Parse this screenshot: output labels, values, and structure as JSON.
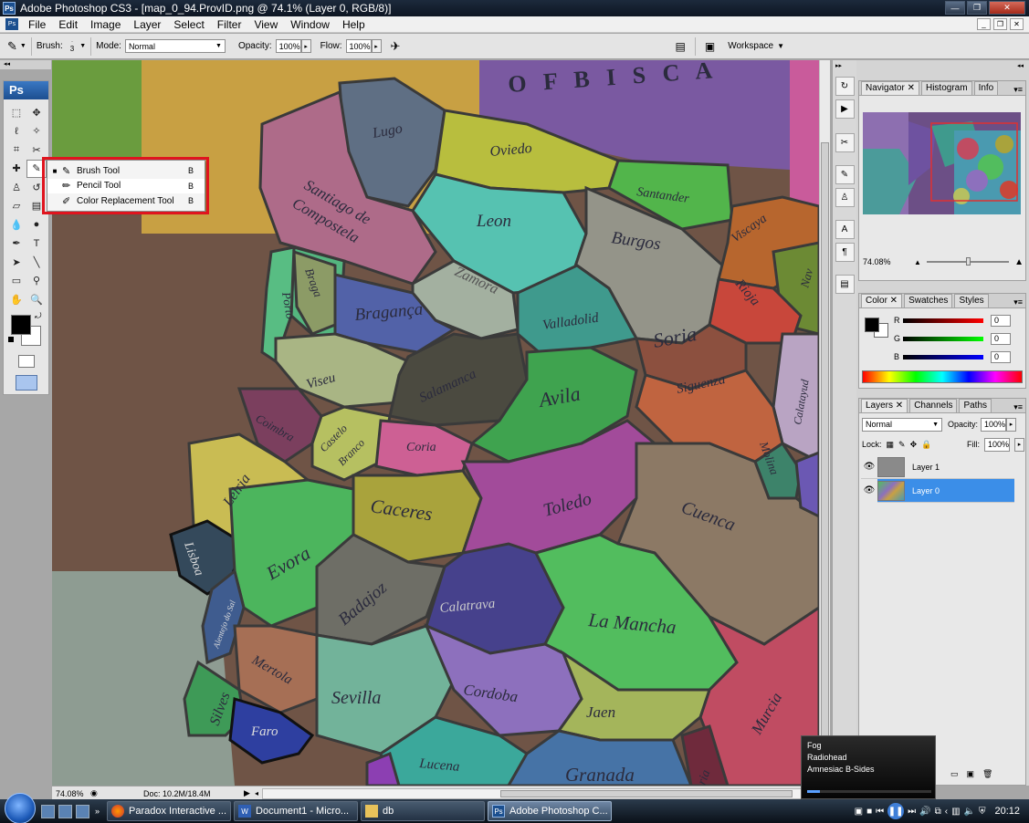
{
  "window": {
    "title": "Adobe Photoshop CS3 - [map_0_94.ProvID.png @ 74.1% (Layer 0, RGB/8)]"
  },
  "menu": [
    "File",
    "Edit",
    "Image",
    "Layer",
    "Select",
    "Filter",
    "View",
    "Window",
    "Help"
  ],
  "options": {
    "brush_label": "Brush:",
    "brush_size": "3",
    "mode_label": "Mode:",
    "mode_value": "Normal",
    "opacity_label": "Opacity:",
    "opacity_value": "100%",
    "flow_label": "Flow:",
    "flow_value": "100%",
    "workspace_label": "Workspace"
  },
  "toolbox": {
    "logo": "Ps"
  },
  "flyout": [
    {
      "label": "Brush Tool",
      "key": "B",
      "icon": "brush-icon",
      "active": true
    },
    {
      "label": "Pencil Tool",
      "key": "B",
      "icon": "pencil-icon",
      "active": false
    },
    {
      "label": "Color Replacement Tool",
      "key": "B",
      "icon": "color-replacement-icon",
      "active": false
    }
  ],
  "map_labels": {
    "bisca": "O F   B I S C A",
    "lugo": "Lugo",
    "oviedo": "Oviedo",
    "santiago": "Santiago de",
    "compostela": "Compostela",
    "santander": "Santander",
    "leon": "Leon",
    "burgos": "Burgos",
    "viscaya": "Viscaya",
    "nav": "Nav",
    "zamora": "Zamora",
    "braga": "Braga",
    "porto": "Porto",
    "braganca": "Bragança",
    "valladolid": "Valladolid",
    "soria": "Soria",
    "rioja": "Rioja",
    "viseu": "Viseu",
    "salamanca": "Salamanca",
    "avila": "Avila",
    "siguenza": "Siguenza",
    "calatayud": "Calatayud",
    "coimbra": "Coimbra",
    "castelo": "Castelo",
    "branco": "Branco",
    "coria": "Coria",
    "molina": "Molina",
    "leiria": "Leiria",
    "caceres": "Caceres",
    "toledo": "Toledo",
    "cuenca": "Cuenca",
    "lisboa": "Lisboa",
    "evora": "Evora",
    "badajoz": "Badajoz",
    "calatrava": "Calatrava",
    "lamancha": "La Mancha",
    "alentejo": "Alentejo do Sal",
    "mertola": "Mertola",
    "sevilla": "Sevilla",
    "cordoba": "Cordoba",
    "jaen": "Jaen",
    "murcia": "Murcia",
    "silves": "Silves",
    "faro": "Faro",
    "lucena": "Lucena",
    "granada": "Granada",
    "ria": "ria"
  },
  "status": {
    "zoom": "74.08%",
    "doc": "Doc: 10.2M/18.4M"
  },
  "navigator": {
    "tabs": [
      "Navigator",
      "Histogram",
      "Info"
    ],
    "zoom": "74.08%"
  },
  "color_panel": {
    "tabs": [
      "Color",
      "Swatches",
      "Styles"
    ],
    "channels": [
      {
        "label": "R",
        "value": "0"
      },
      {
        "label": "G",
        "value": "0"
      },
      {
        "label": "B",
        "value": "0"
      }
    ]
  },
  "layers_panel": {
    "tabs": [
      "Layers",
      "Channels",
      "Paths"
    ],
    "blend_mode": "Normal",
    "opacity_label": "Opacity:",
    "opacity_value": "100%",
    "lock_label": "Lock:",
    "fill_label": "Fill:",
    "fill_value": "100%",
    "layers": [
      {
        "name": "Layer 1",
        "selected": false
      },
      {
        "name": "Layer 0",
        "selected": true
      }
    ]
  },
  "media_popup": {
    "song": "Fog",
    "artist": "Radiohead",
    "album": "Amnesiac B-Sides"
  },
  "taskbar": {
    "tasks": [
      {
        "label": "Paradox Interactive ...",
        "icon": "firefox-icon"
      },
      {
        "label": "Document1 - Micro...",
        "icon": "word-icon"
      },
      {
        "label": "db",
        "icon": "folder-icon"
      },
      {
        "label": "Adobe Photoshop C...",
        "icon": "photoshop-icon",
        "active": true
      }
    ],
    "clock": "20:12"
  }
}
